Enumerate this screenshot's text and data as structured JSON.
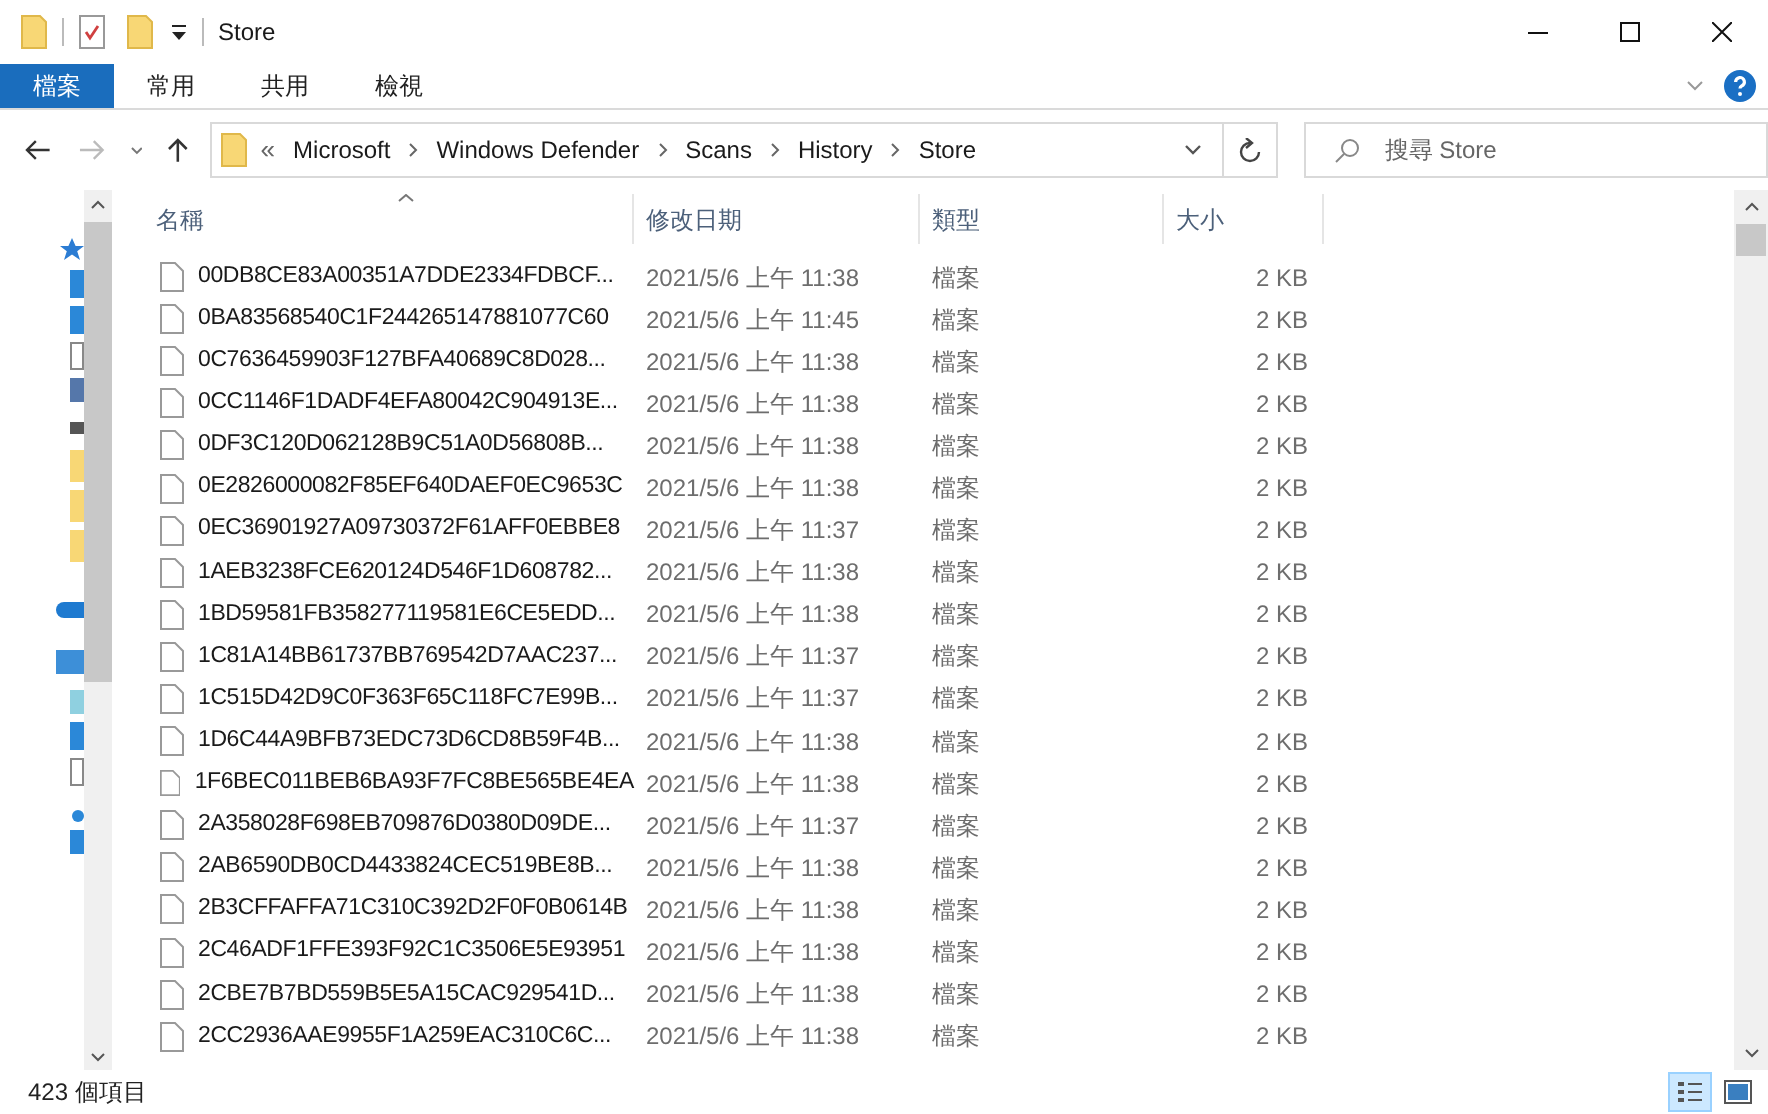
{
  "window": {
    "title": "Store"
  },
  "ribbon_tabs": [
    {
      "label": "檔案",
      "selected": true
    },
    {
      "label": "常用",
      "selected": false
    },
    {
      "label": "共用",
      "selected": false
    },
    {
      "label": "檢視",
      "selected": false
    }
  ],
  "address_bar": {
    "overflow": "«",
    "path": [
      "Microsoft",
      "Windows Defender",
      "Scans",
      "History",
      "Store"
    ]
  },
  "search": {
    "placeholder": "搜尋 Store"
  },
  "table": {
    "columns": [
      "名稱",
      "修改日期",
      "類型",
      "大小"
    ],
    "rows": [
      {
        "name": "00DB8CE83A00351A7DDE2334FDBCF...",
        "modified": "2021/5/6 上午 11:38",
        "type": "檔案",
        "size": "2 KB"
      },
      {
        "name": "0BA83568540C1F244265147881077C60",
        "modified": "2021/5/6 上午 11:45",
        "type": "檔案",
        "size": "2 KB"
      },
      {
        "name": "0C7636459903F127BFA40689C8D028...",
        "modified": "2021/5/6 上午 11:38",
        "type": "檔案",
        "size": "2 KB"
      },
      {
        "name": "0CC1146F1DADF4EFA80042C904913E...",
        "modified": "2021/5/6 上午 11:38",
        "type": "檔案",
        "size": "2 KB"
      },
      {
        "name": "0DF3C120D062128B9C51A0D56808B...",
        "modified": "2021/5/6 上午 11:38",
        "type": "檔案",
        "size": "2 KB"
      },
      {
        "name": "0E2826000082F85EF640DAEF0EC9653C",
        "modified": "2021/5/6 上午 11:38",
        "type": "檔案",
        "size": "2 KB"
      },
      {
        "name": "0EC36901927A09730372F61AFF0EBBE8",
        "modified": "2021/5/6 上午 11:37",
        "type": "檔案",
        "size": "2 KB"
      },
      {
        "name": "1AEB3238FCE620124D546F1D608782...",
        "modified": "2021/5/6 上午 11:38",
        "type": "檔案",
        "size": "2 KB"
      },
      {
        "name": "1BD59581FB358277119581E6CE5EDD...",
        "modified": "2021/5/6 上午 11:38",
        "type": "檔案",
        "size": "2 KB"
      },
      {
        "name": "1C81A14BB61737BB769542D7AAC237...",
        "modified": "2021/5/6 上午 11:37",
        "type": "檔案",
        "size": "2 KB"
      },
      {
        "name": "1C515D42D9C0F363F65C118FC7E99B...",
        "modified": "2021/5/6 上午 11:37",
        "type": "檔案",
        "size": "2 KB"
      },
      {
        "name": "1D6C44A9BFB73EDC73D6CD8B59F4B...",
        "modified": "2021/5/6 上午 11:38",
        "type": "檔案",
        "size": "2 KB"
      },
      {
        "name": "1F6BEC011BEB6BA93F7FC8BE565BE4EA",
        "modified": "2021/5/6 上午 11:38",
        "type": "檔案",
        "size": "2 KB"
      },
      {
        "name": "2A358028F698EB709876D0380D09DE...",
        "modified": "2021/5/6 上午 11:37",
        "type": "檔案",
        "size": "2 KB"
      },
      {
        "name": "2AB6590DB0CD4433824CEC519BE8B...",
        "modified": "2021/5/6 上午 11:38",
        "type": "檔案",
        "size": "2 KB"
      },
      {
        "name": "2B3CFFAFFA71C310C392D2F0F0B0614B",
        "modified": "2021/5/6 上午 11:38",
        "type": "檔案",
        "size": "2 KB"
      },
      {
        "name": "2C46ADF1FFE393F92C1C3506E5E93951",
        "modified": "2021/5/6 上午 11:38",
        "type": "檔案",
        "size": "2 KB"
      },
      {
        "name": "2CBE7B7BD559B5E5A15CAC929541D...",
        "modified": "2021/5/6 上午 11:38",
        "type": "檔案",
        "size": "2 KB"
      },
      {
        "name": "2CC2936AAE9955F1A259EAC310C6C...",
        "modified": "2021/5/6 上午 11:38",
        "type": "檔案",
        "size": "2 KB"
      }
    ]
  },
  "status_bar": {
    "item_count": "423 個項目"
  },
  "view_buttons": [
    {
      "kind": "details",
      "selected": true
    },
    {
      "kind": "thumbnails",
      "selected": false
    }
  ]
}
